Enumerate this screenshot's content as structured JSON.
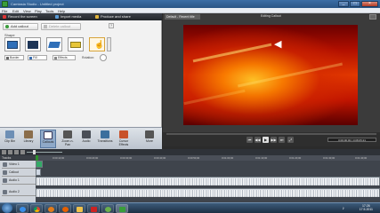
{
  "window": {
    "title": "Camtasia Studio - Untitled project"
  },
  "menu": [
    "File",
    "Edit",
    "View",
    "Play",
    "Tools",
    "Help"
  ],
  "toolbar": {
    "record": "Record the screen",
    "import": "Import media",
    "produce": "Produce and share"
  },
  "callout": {
    "add_label": "Add callout",
    "delete_label": "Delete callout",
    "shape_label": "Shape",
    "border_label": "Border",
    "fill_label": "Fill",
    "effects_label": "Effects",
    "rotation_label": "Rotation:"
  },
  "preview": {
    "tab_label": "Default - Recent title",
    "title": "Editing Callout",
    "timecode": "0:00:00:00 / 0:08:05:21"
  },
  "tools": [
    {
      "label": "Clip Bin"
    },
    {
      "label": "Library"
    },
    {
      "label": "Callouts"
    },
    {
      "label": "Zoom-n-Pan"
    },
    {
      "label": "Audio"
    },
    {
      "label": "Transitions"
    },
    {
      "label": "Cursor Effects"
    },
    {
      "label": "More"
    }
  ],
  "timeline": {
    "tracks_label": "Tracks",
    "ticks": [
      "0:00:10;00",
      "0:00:20;00",
      "0:00:30;00",
      "0:00:40;00",
      "0:00:50;00",
      "0:01:00;00",
      "0:01:10;00",
      "0:01:20;00",
      "0:01:30;00",
      "0:01:40;00"
    ],
    "track_names": [
      "Video 1",
      "Callout",
      "Audio 1",
      "Audio 2"
    ]
  },
  "clock": {
    "time": "17:26",
    "date": "17.5.2011"
  },
  "icons": [
    "camtasia-icon",
    "start-orb-icon",
    "ie-icon",
    "chrome-icon",
    "media-player-icon",
    "firefox-icon",
    "folder-icon",
    "pdf-icon",
    "paint-icon",
    "camtasia-task-icon",
    "speaker-icon"
  ]
}
